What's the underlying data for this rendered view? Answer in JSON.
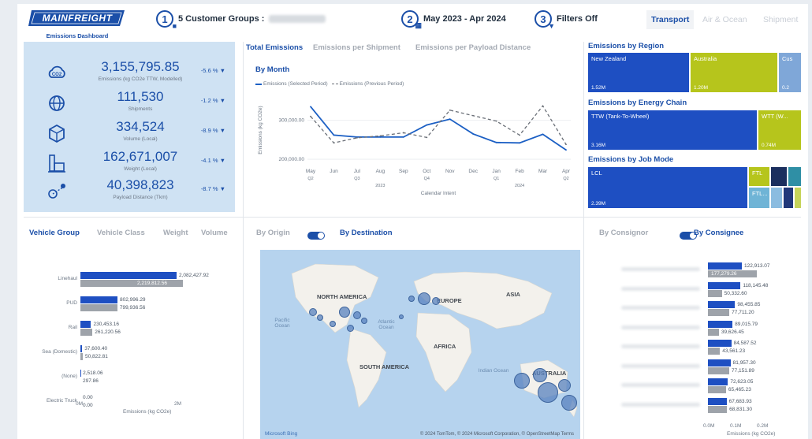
{
  "header": {
    "logo_text": "MAINFREIGHT",
    "subtitle": "Emissions Dashboard",
    "step1_num": "1",
    "step1_label": "5 Customer Groups :",
    "step2_num": "2",
    "step2_label": "May 2023 - Apr 2024",
    "step3_num": "3",
    "step3_label": "Filters Off",
    "mode_tabs": [
      "Transport",
      "Air & Ocean",
      "Shipment"
    ]
  },
  "kpis": [
    {
      "icon": "co2-cloud-icon",
      "value": "3,155,795.85",
      "label": "Emissions (kg CO2e TTW, Modelled)",
      "change": "-5.6 % ▼"
    },
    {
      "icon": "globe-icon",
      "value": "111,530",
      "label": "Shipments",
      "change": "-1.2 % ▼"
    },
    {
      "icon": "package-icon",
      "value": "334,524",
      "label": "Volume (Local)",
      "change": "-8.9 % ▼"
    },
    {
      "icon": "scale-icon",
      "value": "162,671,007",
      "label": "Weight (Local)",
      "change": "-4.1 % ▼"
    },
    {
      "icon": "distance-icon",
      "value": "40,398,823",
      "label": "Payload Distance (Tkm)",
      "change": "-8.7 % ▼"
    }
  ],
  "emission_tabs": [
    "Total Emissions",
    "Emissions per Shipment",
    "Emissions per Payload Distance"
  ],
  "by_month": {
    "title": "By Month",
    "legend_selected": "Emissions (Selected Period)",
    "legend_previous": "Emissions (Previous Period)",
    "ylabel": "Emissions (kg CO2e)",
    "xlabel": "Calendar Intent",
    "y_ticks": [
      "300,000.00",
      "200,000.00"
    ],
    "x_ticks": [
      "May",
      "Jun",
      "Jul",
      "Aug",
      "Sep",
      "Oct",
      "Nov",
      "Dec",
      "Jan",
      "Feb",
      "Mar",
      "Apr"
    ],
    "quarter_ticks": [
      "Q2",
      "Q3",
      "Q4",
      "Q1",
      "Q2"
    ],
    "year_ticks": [
      "2023",
      "2024"
    ]
  },
  "chart_data": {
    "type": "line",
    "title": "By Month",
    "xlabel": "Calendar Intent",
    "ylabel": "Emissions (kg CO2e)",
    "x": [
      "May",
      "Jun",
      "Jul",
      "Aug",
      "Sep",
      "Oct",
      "Nov",
      "Dec",
      "Jan",
      "Feb",
      "Mar",
      "Apr"
    ],
    "ylim": [
      190000,
      360000
    ],
    "series": [
      {
        "name": "Emissions (Selected Period)",
        "style": "solid",
        "color": "#1b5fc4",
        "values": [
          335000,
          262000,
          257000,
          257000,
          257000,
          288000,
          303000,
          265000,
          243000,
          242000,
          264000,
          224000
        ]
      },
      {
        "name": "Emissions (Previous Period)",
        "style": "dashed",
        "color": "#6a6f77",
        "values": [
          310000,
          242000,
          255000,
          260000,
          268000,
          256000,
          326000,
          312000,
          298000,
          262000,
          337000,
          238000
        ]
      }
    ]
  },
  "region": {
    "title": "Emissions by Region",
    "cells": [
      {
        "name": "New Zealand",
        "value": "1.52M",
        "color": "#1e4fc2"
      },
      {
        "name": "Australia",
        "value": "1.20M",
        "color": "#b6c51c"
      },
      {
        "name": "Cus",
        "value": "0.2",
        "color": "#7fa7d8"
      }
    ]
  },
  "energy": {
    "title": "Emissions by Energy Chain",
    "cells": [
      {
        "name": "TTW (Tank-To-Wheel)",
        "value": "3.16M",
        "color": "#1e4fc2"
      },
      {
        "name": "WTT (W...",
        "value": "0.74M",
        "color": "#b6c51c"
      }
    ]
  },
  "jobmode": {
    "title": "Emissions by Job Mode",
    "cells": [
      {
        "name": "LCL",
        "value": "2.39M",
        "color": "#1e4fc2"
      },
      {
        "name": "FTL",
        "value": "",
        "color": "#b6c51c"
      },
      {
        "name": "FTL...",
        "value": "",
        "color": "#6fb4d6"
      }
    ]
  },
  "vehicle": {
    "tabs": [
      "Vehicle Group",
      "Vehicle Class",
      "Weight",
      "Volume"
    ],
    "xlabel": "Emissions (kg CO2e)",
    "x_ticks": [
      "0M",
      "2M"
    ],
    "rows": [
      {
        "label": "Linehaul",
        "current": 2082427.92,
        "previous": 2219812.56,
        "current_text": "2,082,427.92",
        "previous_text": "2,219,812.56"
      },
      {
        "label": "PUD",
        "current": 802996.29,
        "previous": 799936.56,
        "current_text": "802,996.29",
        "previous_text": "799,936.56"
      },
      {
        "label": "Rail",
        "current": 230453.16,
        "previous": 261220.56,
        "current_text": "230,453.16",
        "previous_text": "261,220.56"
      },
      {
        "label": "Sea (Domestic)",
        "current": 37600.4,
        "previous": 50822.81,
        "current_text": "37,600.40",
        "previous_text": "50,822.81"
      },
      {
        "label": "(None)",
        "current": 2518.06,
        "previous": 297.86,
        "current_text": "2,518.06",
        "previous_text": "297.86"
      },
      {
        "label": "Electric Truck",
        "current": 0,
        "previous": 0,
        "current_text": "0.00",
        "previous_text": "0.00"
      }
    ]
  },
  "origin_dest": {
    "left": "By Origin",
    "right": "By Destination"
  },
  "map": {
    "labels": [
      "NORTH AMERICA",
      "EUROPE",
      "ASIA",
      "AFRICA",
      "SOUTH AMERICA",
      "AUSTRALIA"
    ],
    "oceans": [
      "Pacific Ocean",
      "Atlantic Ocean",
      "Indian Ocean"
    ],
    "footer_left": "Microsoft Bing",
    "footer_right": "© 2024 TomTom, © 2024 Microsoft Corporation, © OpenStreetMap Terms"
  },
  "consignee": {
    "left": "By Consignor",
    "right": "By Consignee",
    "xlabel": "Emissions (kg CO2e)",
    "x_ticks": [
      "0.0M",
      "0.1M",
      "0.2M"
    ],
    "rows": [
      {
        "current": 122913.07,
        "previous": 177279.26,
        "current_text": "122,913.07",
        "previous_text": "177,279.26"
      },
      {
        "current": 118145.48,
        "previous": 50332.6,
        "current_text": "118,145.48",
        "previous_text": "50,332.60"
      },
      {
        "current": 98455.85,
        "previous": 77711.2,
        "current_text": "98,455.85",
        "previous_text": "77,711.20"
      },
      {
        "current": 89015.79,
        "previous": 39626.45,
        "current_text": "89,015.79",
        "previous_text": "39,626.45"
      },
      {
        "current": 84587.52,
        "previous": 43561.23,
        "current_text": "84,587.52",
        "previous_text": "43,561.23"
      },
      {
        "current": 81957.3,
        "previous": 77151.89,
        "current_text": "81,957.30",
        "previous_text": "77,151.89"
      },
      {
        "current": 72623.05,
        "previous": 65465.23,
        "current_text": "72,623.05",
        "previous_text": "65,465.23"
      },
      {
        "current": 67683.93,
        "previous": 68831.3,
        "current_text": "67,683.93",
        "previous_text": "68,831.30"
      }
    ]
  }
}
